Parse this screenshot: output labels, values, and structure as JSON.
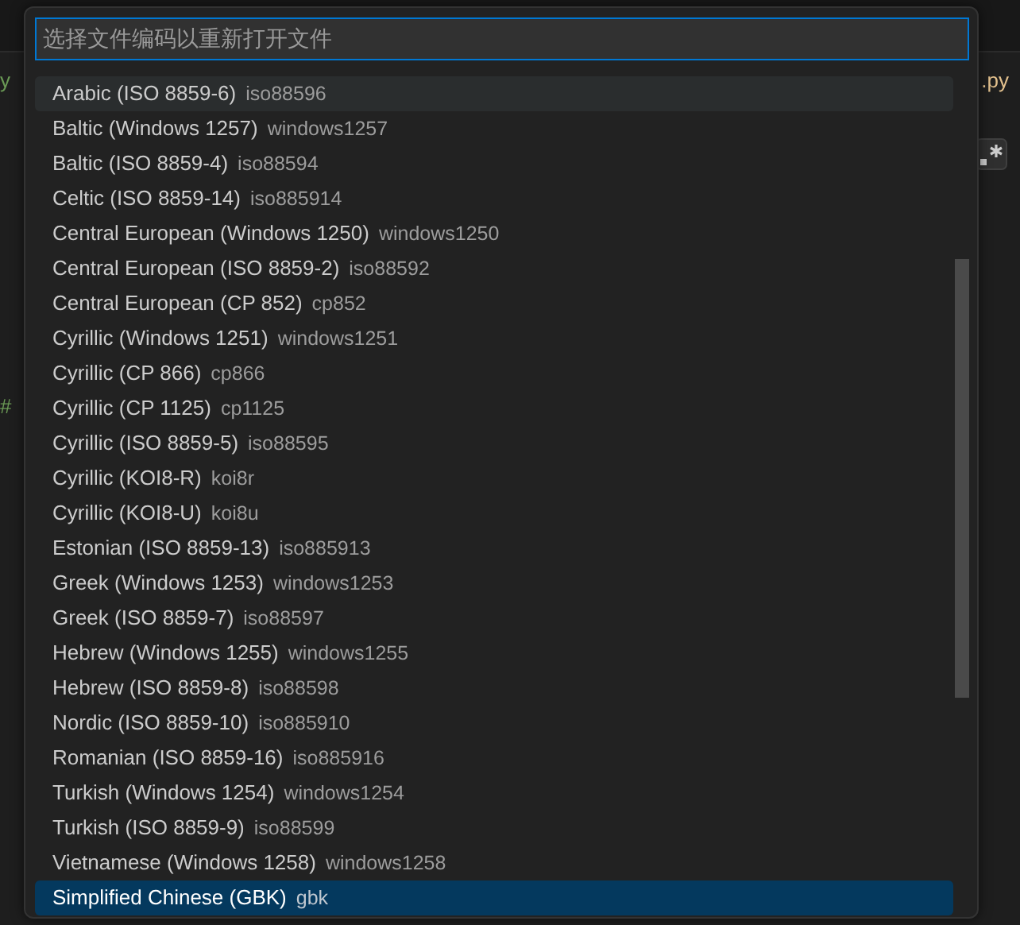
{
  "background": {
    "left_fragments": [
      "y",
      "#"
    ],
    "right_fragment": ".py"
  },
  "picker": {
    "placeholder": "选择文件编码以重新打开文件",
    "items": [
      {
        "label": "Arabic (ISO 8859-6)",
        "description": "iso88596",
        "hovered": true,
        "selected": false
      },
      {
        "label": "Baltic (Windows 1257)",
        "description": "windows1257",
        "hovered": false,
        "selected": false
      },
      {
        "label": "Baltic (ISO 8859-4)",
        "description": "iso88594",
        "hovered": false,
        "selected": false
      },
      {
        "label": "Celtic (ISO 8859-14)",
        "description": "iso885914",
        "hovered": false,
        "selected": false
      },
      {
        "label": "Central European (Windows 1250)",
        "description": "windows1250",
        "hovered": false,
        "selected": false
      },
      {
        "label": "Central European (ISO 8859-2)",
        "description": "iso88592",
        "hovered": false,
        "selected": false
      },
      {
        "label": "Central European (CP 852)",
        "description": "cp852",
        "hovered": false,
        "selected": false
      },
      {
        "label": "Cyrillic (Windows 1251)",
        "description": "windows1251",
        "hovered": false,
        "selected": false
      },
      {
        "label": "Cyrillic (CP 866)",
        "description": "cp866",
        "hovered": false,
        "selected": false
      },
      {
        "label": "Cyrillic (CP 1125)",
        "description": "cp1125",
        "hovered": false,
        "selected": false
      },
      {
        "label": "Cyrillic (ISO 8859-5)",
        "description": "iso88595",
        "hovered": false,
        "selected": false
      },
      {
        "label": "Cyrillic (KOI8-R)",
        "description": "koi8r",
        "hovered": false,
        "selected": false
      },
      {
        "label": "Cyrillic (KOI8-U)",
        "description": "koi8u",
        "hovered": false,
        "selected": false
      },
      {
        "label": "Estonian (ISO 8859-13)",
        "description": "iso885913",
        "hovered": false,
        "selected": false
      },
      {
        "label": "Greek (Windows 1253)",
        "description": "windows1253",
        "hovered": false,
        "selected": false
      },
      {
        "label": "Greek (ISO 8859-7)",
        "description": "iso88597",
        "hovered": false,
        "selected": false
      },
      {
        "label": "Hebrew (Windows 1255)",
        "description": "windows1255",
        "hovered": false,
        "selected": false
      },
      {
        "label": "Hebrew (ISO 8859-8)",
        "description": "iso88598",
        "hovered": false,
        "selected": false
      },
      {
        "label": "Nordic (ISO 8859-10)",
        "description": "iso885910",
        "hovered": false,
        "selected": false
      },
      {
        "label": "Romanian (ISO 8859-16)",
        "description": "iso885916",
        "hovered": false,
        "selected": false
      },
      {
        "label": "Turkish (Windows 1254)",
        "description": "windows1254",
        "hovered": false,
        "selected": false
      },
      {
        "label": "Turkish (ISO 8859-9)",
        "description": "iso88599",
        "hovered": false,
        "selected": false
      },
      {
        "label": "Vietnamese (Windows 1258)",
        "description": "windows1258",
        "hovered": false,
        "selected": false
      },
      {
        "label": "Simplified Chinese (GBK)",
        "description": "gbk",
        "hovered": false,
        "selected": true
      }
    ]
  }
}
